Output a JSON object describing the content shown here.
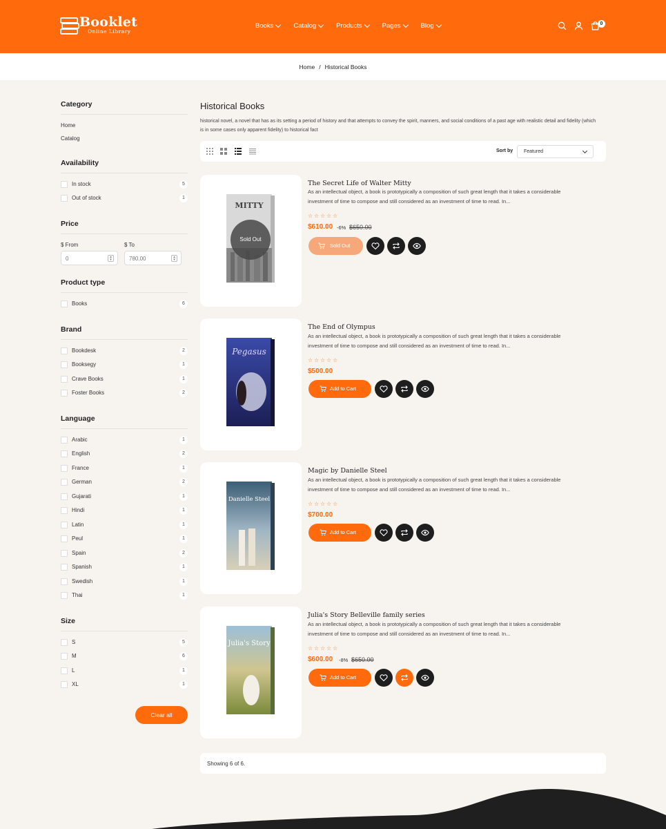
{
  "brand": {
    "name": "Booklet",
    "tagline": "Online Library",
    "accent_color": "#ff6a0d"
  },
  "nav": {
    "items": [
      {
        "label": "Books",
        "icon": "chevron-down-icon"
      },
      {
        "label": "Catalog",
        "icon": "chevron-down-icon"
      },
      {
        "label": "Products",
        "icon": "chevron-down-icon"
      },
      {
        "label": "Pages",
        "icon": "chevron-down-icon"
      },
      {
        "label": "Blog",
        "icon": "chevron-down-icon"
      }
    ]
  },
  "header_icons": {
    "search": "search-icon",
    "account": "user-icon",
    "cart": "cart-icon",
    "cart_count": "0"
  },
  "breadcrumb": {
    "home": "Home",
    "separator": "/",
    "current": "Historical Books"
  },
  "filters": {
    "category": {
      "title": "Category",
      "links": [
        "Home",
        "Catalog"
      ]
    },
    "availability": {
      "title": "Availability",
      "options": [
        {
          "label": "In stock",
          "count": "5"
        },
        {
          "label": "Out of stock",
          "count": "1"
        }
      ]
    },
    "price": {
      "title": "Price",
      "from_label": "$ From",
      "to_label": "$ To",
      "from_placeholder": "0",
      "to_placeholder": "780.00"
    },
    "product_type": {
      "title": "Product type",
      "options": [
        {
          "label": "Books",
          "count": "6"
        }
      ]
    },
    "brand": {
      "title": "Brand",
      "options": [
        {
          "label": "Bookdesk",
          "count": "2"
        },
        {
          "label": "Booksegy",
          "count": "1"
        },
        {
          "label": "Crave Books",
          "count": "1"
        },
        {
          "label": "Foster Books",
          "count": "2"
        }
      ]
    },
    "language": {
      "title": "Language",
      "options": [
        {
          "label": "Arabic",
          "count": "1"
        },
        {
          "label": "English",
          "count": "2"
        },
        {
          "label": "France",
          "count": "1"
        },
        {
          "label": "German",
          "count": "2"
        },
        {
          "label": "Gujarati",
          "count": "1"
        },
        {
          "label": "Hindi",
          "count": "1"
        },
        {
          "label": "Latin",
          "count": "1"
        },
        {
          "label": "Peul",
          "count": "1"
        },
        {
          "label": "Spain",
          "count": "2"
        },
        {
          "label": "Spanish",
          "count": "1"
        },
        {
          "label": "Swedish",
          "count": "1"
        },
        {
          "label": "Thai",
          "count": "1"
        }
      ]
    },
    "size": {
      "title": "Size",
      "options": [
        {
          "label": "S",
          "count": "5"
        },
        {
          "label": "M",
          "count": "6"
        },
        {
          "label": "L",
          "count": "1"
        },
        {
          "label": "XL",
          "count": "1"
        }
      ]
    },
    "clear_label": "Clear all"
  },
  "collection": {
    "title": "Historical Books",
    "description": "historical novel, a novel that has as its setting a period of history and that attempts to convey the spirit, manners, and social conditions of a past age with realistic detail and fidelity (which is in some cases only apparent fidelity) to historical fact",
    "sort_label": "Sort by",
    "sort_value": "Featured",
    "view_modes": [
      "grid-4-icon",
      "grid-2-icon",
      "list-icon",
      "list-compact-icon"
    ]
  },
  "products": [
    {
      "title": "The Secret Life of Walter Mitty",
      "description_line1": "As an intellectual object, a book is prototypically a composition of such great length that it takes a considerable",
      "description_line2": "investment of time to compose and still considered as an investment of time to read. In...",
      "price": "$610.00",
      "discount": "-6%",
      "compare_price": "$650.00",
      "button": "Sold Out",
      "sold_out": true,
      "overlay": "Sold Out",
      "rating": 0,
      "cover_text": "MITTY"
    },
    {
      "title": "The End of Olympus",
      "description_line1": "As an intellectual object, a book is prototypically a composition of such great length that it takes a considerable",
      "description_line2": "investment of time to compose and still considered as an investment of time to read. In...",
      "price": "$500.00",
      "button": "Add to Cart",
      "sold_out": false,
      "rating": 0,
      "cover_text": "Pegasus"
    },
    {
      "title": "Magic by Danielle Steel",
      "description_line1": "As an intellectual object, a book is prototypically a composition of such great length that it takes a considerable",
      "description_line2": "investment of time to compose and still considered as an investment of time to read. In...",
      "price": "$700.00",
      "button": "Add to Cart",
      "sold_out": false,
      "rating": 0,
      "cover_text": "Danielle Steel"
    },
    {
      "title": "Julia's Story Belleville family series",
      "description_line1": "As an intellectual object, a book is prototypically a composition of such great length that it takes a considerable",
      "description_line2": "investment of time to compose and still considered as an investment of time to read. In...",
      "price": "$600.00",
      "discount": "-8%",
      "compare_price": "$650.00",
      "button": "Add to Cart",
      "sold_out": false,
      "rating": 0,
      "cover_text": "Julia's Story"
    }
  ],
  "pagination": {
    "showing": "Showing 6 of 6."
  }
}
